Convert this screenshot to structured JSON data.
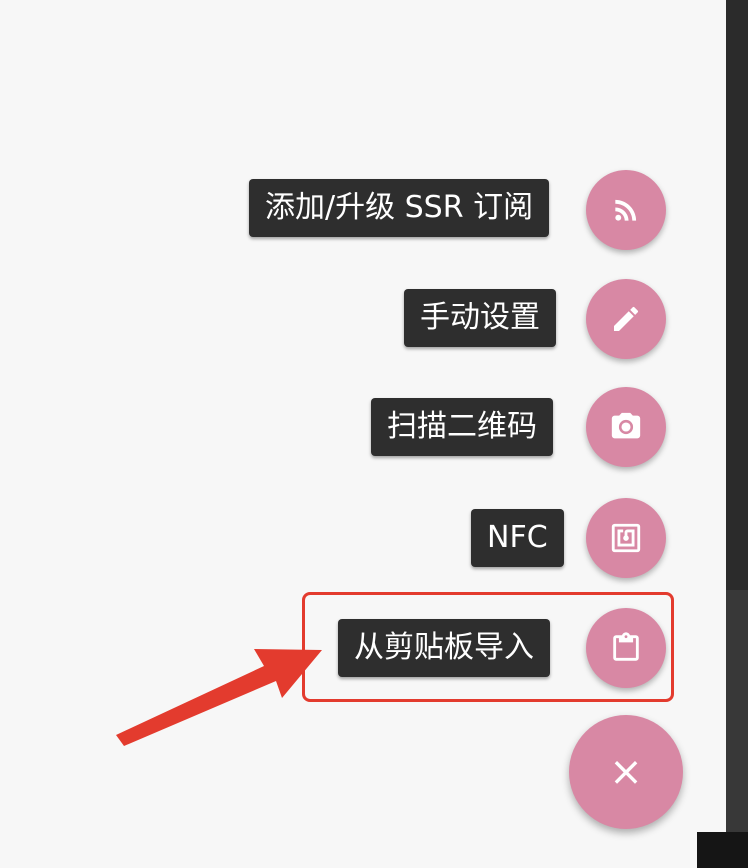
{
  "fab_menu": {
    "items": [
      {
        "label": "添加/升级 SSR 订阅",
        "icon": "rss-icon"
      },
      {
        "label": "手动设置",
        "icon": "pencil-icon"
      },
      {
        "label": "扫描二维码",
        "icon": "camera-icon"
      },
      {
        "label": "NFC",
        "icon": "nfc-icon"
      },
      {
        "label": "从剪贴板导入",
        "icon": "clipboard-icon"
      }
    ],
    "close_icon": "close-icon",
    "close_glyph": "×"
  },
  "colors": {
    "fab": "#d888a4",
    "label_bg": "#2e2e2e",
    "annotation": "#e33b2e",
    "background": "#f7f7f7"
  }
}
